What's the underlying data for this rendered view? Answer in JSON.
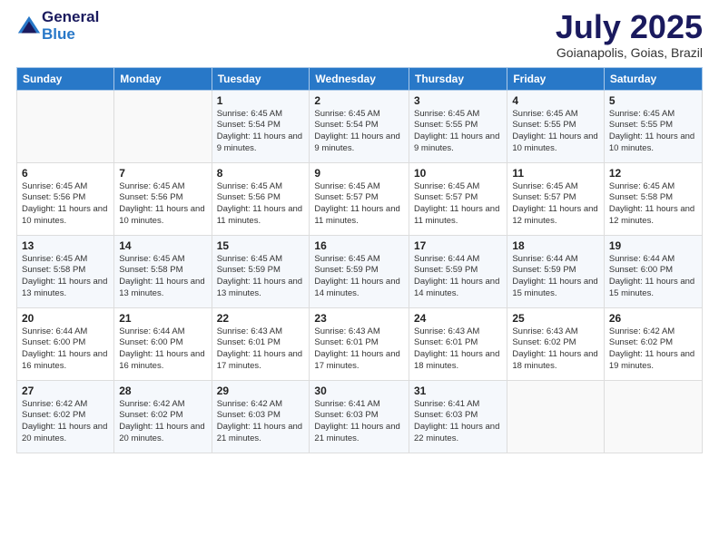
{
  "logo": {
    "general": "General",
    "blue": "Blue"
  },
  "title": {
    "month": "July 2025",
    "location": "Goianapolis, Goias, Brazil"
  },
  "headers": [
    "Sunday",
    "Monday",
    "Tuesday",
    "Wednesday",
    "Thursday",
    "Friday",
    "Saturday"
  ],
  "weeks": [
    [
      {
        "day": "",
        "sunrise": "",
        "sunset": "",
        "daylight": ""
      },
      {
        "day": "",
        "sunrise": "",
        "sunset": "",
        "daylight": ""
      },
      {
        "day": "1",
        "sunrise": "Sunrise: 6:45 AM",
        "sunset": "Sunset: 5:54 PM",
        "daylight": "Daylight: 11 hours and 9 minutes."
      },
      {
        "day": "2",
        "sunrise": "Sunrise: 6:45 AM",
        "sunset": "Sunset: 5:54 PM",
        "daylight": "Daylight: 11 hours and 9 minutes."
      },
      {
        "day": "3",
        "sunrise": "Sunrise: 6:45 AM",
        "sunset": "Sunset: 5:55 PM",
        "daylight": "Daylight: 11 hours and 9 minutes."
      },
      {
        "day": "4",
        "sunrise": "Sunrise: 6:45 AM",
        "sunset": "Sunset: 5:55 PM",
        "daylight": "Daylight: 11 hours and 10 minutes."
      },
      {
        "day": "5",
        "sunrise": "Sunrise: 6:45 AM",
        "sunset": "Sunset: 5:55 PM",
        "daylight": "Daylight: 11 hours and 10 minutes."
      }
    ],
    [
      {
        "day": "6",
        "sunrise": "Sunrise: 6:45 AM",
        "sunset": "Sunset: 5:56 PM",
        "daylight": "Daylight: 11 hours and 10 minutes."
      },
      {
        "day": "7",
        "sunrise": "Sunrise: 6:45 AM",
        "sunset": "Sunset: 5:56 PM",
        "daylight": "Daylight: 11 hours and 10 minutes."
      },
      {
        "day": "8",
        "sunrise": "Sunrise: 6:45 AM",
        "sunset": "Sunset: 5:56 PM",
        "daylight": "Daylight: 11 hours and 11 minutes."
      },
      {
        "day": "9",
        "sunrise": "Sunrise: 6:45 AM",
        "sunset": "Sunset: 5:57 PM",
        "daylight": "Daylight: 11 hours and 11 minutes."
      },
      {
        "day": "10",
        "sunrise": "Sunrise: 6:45 AM",
        "sunset": "Sunset: 5:57 PM",
        "daylight": "Daylight: 11 hours and 11 minutes."
      },
      {
        "day": "11",
        "sunrise": "Sunrise: 6:45 AM",
        "sunset": "Sunset: 5:57 PM",
        "daylight": "Daylight: 11 hours and 12 minutes."
      },
      {
        "day": "12",
        "sunrise": "Sunrise: 6:45 AM",
        "sunset": "Sunset: 5:58 PM",
        "daylight": "Daylight: 11 hours and 12 minutes."
      }
    ],
    [
      {
        "day": "13",
        "sunrise": "Sunrise: 6:45 AM",
        "sunset": "Sunset: 5:58 PM",
        "daylight": "Daylight: 11 hours and 13 minutes."
      },
      {
        "day": "14",
        "sunrise": "Sunrise: 6:45 AM",
        "sunset": "Sunset: 5:58 PM",
        "daylight": "Daylight: 11 hours and 13 minutes."
      },
      {
        "day": "15",
        "sunrise": "Sunrise: 6:45 AM",
        "sunset": "Sunset: 5:59 PM",
        "daylight": "Daylight: 11 hours and 13 minutes."
      },
      {
        "day": "16",
        "sunrise": "Sunrise: 6:45 AM",
        "sunset": "Sunset: 5:59 PM",
        "daylight": "Daylight: 11 hours and 14 minutes."
      },
      {
        "day": "17",
        "sunrise": "Sunrise: 6:44 AM",
        "sunset": "Sunset: 5:59 PM",
        "daylight": "Daylight: 11 hours and 14 minutes."
      },
      {
        "day": "18",
        "sunrise": "Sunrise: 6:44 AM",
        "sunset": "Sunset: 5:59 PM",
        "daylight": "Daylight: 11 hours and 15 minutes."
      },
      {
        "day": "19",
        "sunrise": "Sunrise: 6:44 AM",
        "sunset": "Sunset: 6:00 PM",
        "daylight": "Daylight: 11 hours and 15 minutes."
      }
    ],
    [
      {
        "day": "20",
        "sunrise": "Sunrise: 6:44 AM",
        "sunset": "Sunset: 6:00 PM",
        "daylight": "Daylight: 11 hours and 16 minutes."
      },
      {
        "day": "21",
        "sunrise": "Sunrise: 6:44 AM",
        "sunset": "Sunset: 6:00 PM",
        "daylight": "Daylight: 11 hours and 16 minutes."
      },
      {
        "day": "22",
        "sunrise": "Sunrise: 6:43 AM",
        "sunset": "Sunset: 6:01 PM",
        "daylight": "Daylight: 11 hours and 17 minutes."
      },
      {
        "day": "23",
        "sunrise": "Sunrise: 6:43 AM",
        "sunset": "Sunset: 6:01 PM",
        "daylight": "Daylight: 11 hours and 17 minutes."
      },
      {
        "day": "24",
        "sunrise": "Sunrise: 6:43 AM",
        "sunset": "Sunset: 6:01 PM",
        "daylight": "Daylight: 11 hours and 18 minutes."
      },
      {
        "day": "25",
        "sunrise": "Sunrise: 6:43 AM",
        "sunset": "Sunset: 6:02 PM",
        "daylight": "Daylight: 11 hours and 18 minutes."
      },
      {
        "day": "26",
        "sunrise": "Sunrise: 6:42 AM",
        "sunset": "Sunset: 6:02 PM",
        "daylight": "Daylight: 11 hours and 19 minutes."
      }
    ],
    [
      {
        "day": "27",
        "sunrise": "Sunrise: 6:42 AM",
        "sunset": "Sunset: 6:02 PM",
        "daylight": "Daylight: 11 hours and 20 minutes."
      },
      {
        "day": "28",
        "sunrise": "Sunrise: 6:42 AM",
        "sunset": "Sunset: 6:02 PM",
        "daylight": "Daylight: 11 hours and 20 minutes."
      },
      {
        "day": "29",
        "sunrise": "Sunrise: 6:42 AM",
        "sunset": "Sunset: 6:03 PM",
        "daylight": "Daylight: 11 hours and 21 minutes."
      },
      {
        "day": "30",
        "sunrise": "Sunrise: 6:41 AM",
        "sunset": "Sunset: 6:03 PM",
        "daylight": "Daylight: 11 hours and 21 minutes."
      },
      {
        "day": "31",
        "sunrise": "Sunrise: 6:41 AM",
        "sunset": "Sunset: 6:03 PM",
        "daylight": "Daylight: 11 hours and 22 minutes."
      },
      {
        "day": "",
        "sunrise": "",
        "sunset": "",
        "daylight": ""
      },
      {
        "day": "",
        "sunrise": "",
        "sunset": "",
        "daylight": ""
      }
    ]
  ]
}
